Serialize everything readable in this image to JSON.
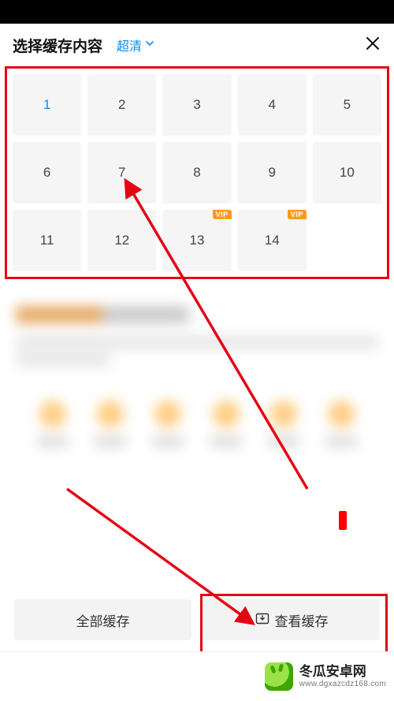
{
  "header": {
    "title": "选择缓存内容",
    "quality_label": "超清",
    "close_aria": "关闭"
  },
  "episodes": [
    {
      "num": "1",
      "selected": true,
      "vip": false
    },
    {
      "num": "2",
      "selected": false,
      "vip": false
    },
    {
      "num": "3",
      "selected": false,
      "vip": false
    },
    {
      "num": "4",
      "selected": false,
      "vip": false
    },
    {
      "num": "5",
      "selected": false,
      "vip": false
    },
    {
      "num": "6",
      "selected": false,
      "vip": false
    },
    {
      "num": "7",
      "selected": false,
      "vip": false
    },
    {
      "num": "8",
      "selected": false,
      "vip": false
    },
    {
      "num": "9",
      "selected": false,
      "vip": false
    },
    {
      "num": "10",
      "selected": false,
      "vip": false
    },
    {
      "num": "11",
      "selected": false,
      "vip": false
    },
    {
      "num": "12",
      "selected": false,
      "vip": false
    },
    {
      "num": "13",
      "selected": false,
      "vip": true
    },
    {
      "num": "14",
      "selected": false,
      "vip": true
    }
  ],
  "vip_label": "VIP",
  "buttons": {
    "cache_all": "全部缓存",
    "view_cache": "查看缓存"
  },
  "watermark": {
    "line1": "冬瓜安卓网",
    "line2": "www.dgxazcdz168.com"
  },
  "colors": {
    "accent": "#0a8cf0",
    "annotation": "#e30613",
    "vip_badge": "#ff9a1f"
  }
}
